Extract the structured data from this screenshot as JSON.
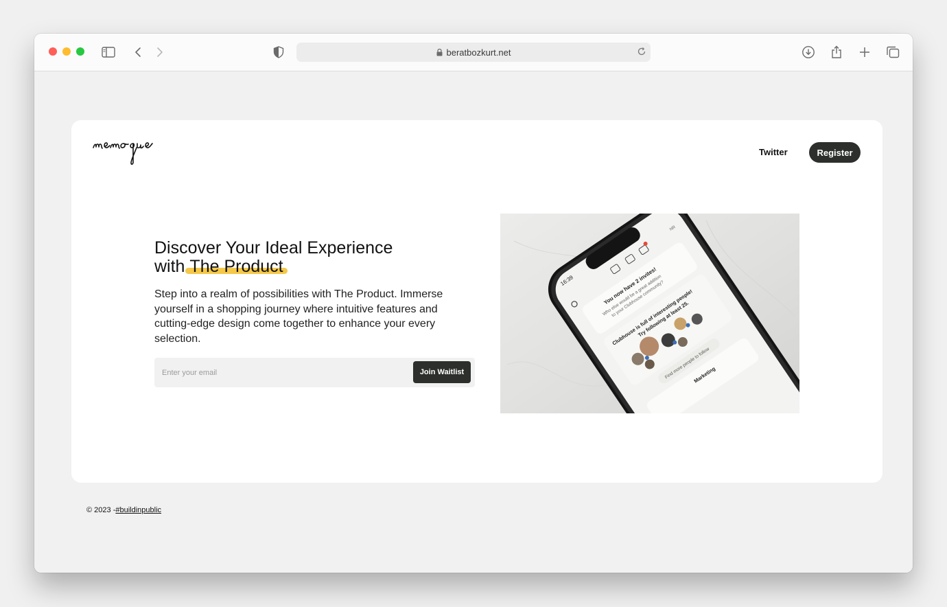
{
  "browser": {
    "url": "beratbozkurt.net"
  },
  "site": {
    "logo_text": "memoque",
    "nav": {
      "twitter_label": "Twitter",
      "register_label": "Register"
    },
    "hero": {
      "title_line1": "Discover Your Ideal Experience",
      "title_with": "with",
      "title_highlight": "The Product",
      "description": "Step into a realm of possibilities with The Product. Immerse yourself in a shopping journey where intuitive features and cutting-edge design come together to enhance your every selection.",
      "email_placeholder": "Enter your email",
      "email_value": "",
      "cta_label": "Join Waitlist"
    },
    "phone_screen": {
      "time": "16:39",
      "initials": "NR",
      "invite_title": "You now have 2 invites!",
      "invite_sub1": "Who else would be a great addition",
      "invite_sub2": "to your Clubhouse community?",
      "follow_title": "Clubhouse is full of interesting people!",
      "follow_sub": "Try following at least 25.",
      "find_more": "Find more people to follow",
      "section": "Marketing"
    },
    "footer": {
      "copyright": "© 2023 -",
      "link": "#buildinpublic"
    }
  },
  "colors": {
    "accent_highlight": "#f4c53f",
    "button_dark": "#2c2f2b"
  }
}
